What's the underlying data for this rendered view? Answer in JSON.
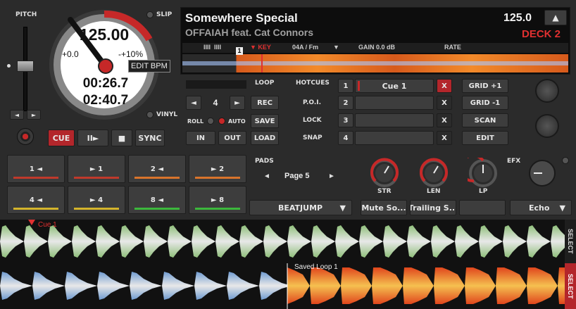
{
  "deck": {
    "pitch_label": "PITCH",
    "slip_label": "SLIP",
    "vinyl_label": "VINYL",
    "bpm": "125.00",
    "pitch_minus": "+0.0",
    "pitch_plus": "-+10%",
    "edit_bpm_tooltip": "EDIT BPM",
    "elapsed": "00:26.7",
    "remaining": "02:40.7",
    "pitch_left_arrow": "◄",
    "pitch_right_arrow": "►",
    "cue_label": "CUE",
    "play_label": "II►",
    "stop_label": "■",
    "sync_label": "SYNC"
  },
  "track": {
    "title": "Somewhere Special",
    "artist": "OFFAIAH feat. Cat Connors",
    "bpm": "125.0",
    "eject_label": "▲",
    "deck_name": "DECK 2",
    "key_label": "KEY",
    "key_value": "04A / Fm",
    "gain_value": "GAIN 0.0 dB",
    "rate_label": "RATE",
    "marker_number": "1"
  },
  "loop": {
    "loop_label": "LOOP",
    "size_value": "4",
    "left_arrow": "◄",
    "right_arrow": "►",
    "rec_label": "REC",
    "roll_label": "ROLL",
    "auto_label": "AUTO",
    "save_label": "SAVE",
    "in_label": "IN",
    "out_label": "OUT",
    "load_label": "LOAD"
  },
  "hotcues": {
    "header": "HOTCUES",
    "rows": [
      {
        "label": "",
        "num": "1",
        "name": "Cue 1",
        "x": "X"
      },
      {
        "label": "P.O.I.",
        "num": "2",
        "name": "",
        "x": "X"
      },
      {
        "label": "LOCK",
        "num": "3",
        "name": "",
        "x": "X"
      },
      {
        "label": "SNAP",
        "num": "4",
        "name": "",
        "x": "X"
      }
    ]
  },
  "grid": {
    "plus_label": "GRID +1",
    "minus_label": "GRID -1",
    "scan_label": "SCAN",
    "edit_label": "EDIT"
  },
  "beatjump": {
    "buttons": [
      {
        "label": "1 ◄",
        "color": "#c0392b"
      },
      {
        "label": "► 1",
        "color": "#c0392b"
      },
      {
        "label": "2 ◄",
        "color": "#d9742b"
      },
      {
        "label": "► 2",
        "color": "#d9742b"
      },
      {
        "label": "4 ◄",
        "color": "#d4b42b"
      },
      {
        "label": "► 4",
        "color": "#d4b42b"
      },
      {
        "label": "8 ◄",
        "color": "#3cb83c"
      },
      {
        "label": "► 8",
        "color": "#3cb83c"
      }
    ]
  },
  "pads": {
    "header": "PADS",
    "left_arrow": "◄",
    "page_label": "Page 5",
    "right_arrow": "►",
    "mode_value": "BEATJUMP",
    "dropdown_arrow": "▼"
  },
  "effects": {
    "knob_labels": [
      "STR",
      "LEN",
      "LP"
    ],
    "efx_label": "EFX",
    "slot1": "Mute So...",
    "slot2": "Trailing S...",
    "slot3": "",
    "effect_name": "Echo",
    "dropdown_arrow": "▼"
  },
  "waveforms": {
    "cue_marker": "Cue 1",
    "loop_marker": "Saved Loop 1",
    "select_label_top": "SELECT",
    "select_label_bottom": "SELECT"
  },
  "colors": {
    "accent_red": "#c62828",
    "deck_red": "#e03030",
    "panel": "#2b2b2b"
  }
}
